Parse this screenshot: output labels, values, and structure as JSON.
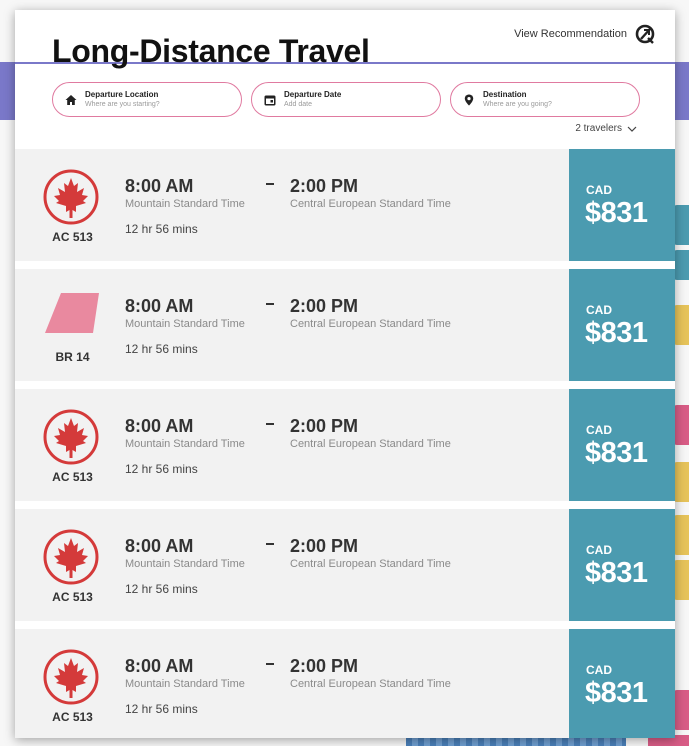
{
  "header": {
    "title": "Long-Distance Travel",
    "recommendation_label": "View Recommendation"
  },
  "search": [
    {
      "label": "Departure Location",
      "placeholder": "Where are you starting?",
      "icon": "home-icon"
    },
    {
      "label": "Departure Date",
      "placeholder": "Add date",
      "icon": "calendar-icon"
    },
    {
      "label": "Destination",
      "placeholder": "Where are you going?",
      "icon": "location-pin-icon"
    }
  ],
  "travelers": "2 travelers",
  "colors": {
    "accent": "#7a78c9",
    "pill_border": "#e07aa0",
    "price_bg": "#4b9bb0",
    "air_canada_red": "#d43a3a",
    "eva_pink": "#e9899f"
  },
  "flights": [
    {
      "code": "AC 513",
      "logo": "air-canada-maple-leaf-logo",
      "depart_time": "8:00 AM",
      "depart_tz": "Mountain Standard Time",
      "duration": "12 hr 56 mins",
      "arrive_time": "2:00 PM",
      "arrive_tz": "Central European Standard Time",
      "currency": "CAD",
      "price": "$831"
    },
    {
      "code": "BR 14",
      "logo": "pink-tail-fin-logo",
      "depart_time": "8:00 AM",
      "depart_tz": "Mountain Standard Time",
      "duration": "12 hr 56 mins",
      "arrive_time": "2:00 PM",
      "arrive_tz": "Central European Standard Time",
      "currency": "CAD",
      "price": "$831"
    },
    {
      "code": "AC 513",
      "logo": "air-canada-maple-leaf-logo",
      "depart_time": "8:00 AM",
      "depart_tz": "Mountain Standard Time",
      "duration": "12 hr 56 mins",
      "arrive_time": "2:00 PM",
      "arrive_tz": "Central European Standard Time",
      "currency": "CAD",
      "price": "$831"
    },
    {
      "code": "AC 513",
      "logo": "air-canada-maple-leaf-logo",
      "depart_time": "8:00 AM",
      "depart_tz": "Mountain Standard Time",
      "duration": "12 hr 56 mins",
      "arrive_time": "2:00 PM",
      "arrive_tz": "Central European Standard Time",
      "currency": "CAD",
      "price": "$831"
    },
    {
      "code": "AC 513",
      "logo": "air-canada-maple-leaf-logo",
      "depart_time": "8:00 AM",
      "depart_tz": "Mountain Standard Time",
      "duration": "12 hr 56 mins",
      "arrive_time": "2:00 PM",
      "arrive_tz": "Central European Standard Time",
      "currency": "CAD",
      "price": "$831"
    }
  ]
}
